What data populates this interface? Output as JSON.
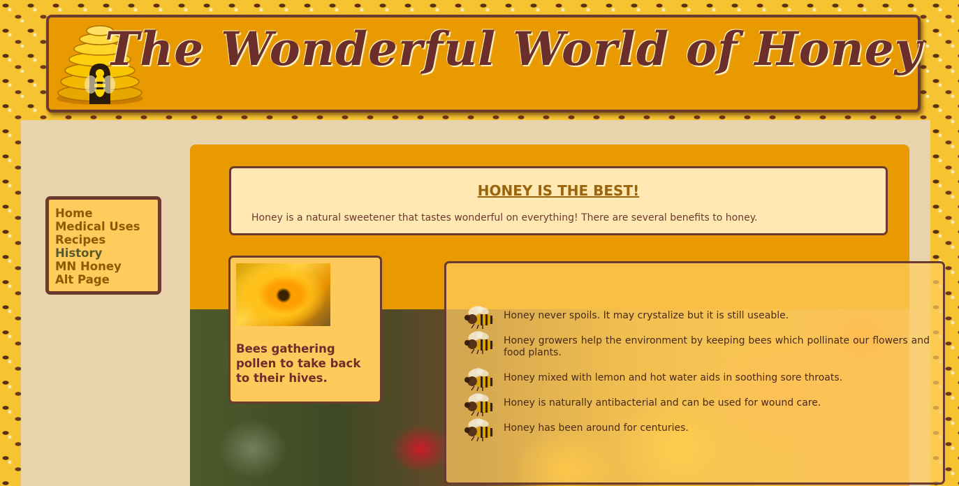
{
  "header": {
    "title": "The Wonderful World of Honey"
  },
  "nav": {
    "items": [
      {
        "label": "Home"
      },
      {
        "label": "Medical Uses"
      },
      {
        "label": "Recipes"
      },
      {
        "label": "History"
      },
      {
        "label": "MN Honey"
      },
      {
        "label": "Alt Page"
      }
    ]
  },
  "intro": {
    "title": "HONEY IS THE BEST!",
    "text": "Honey is a natural sweetener that tastes wonderful on everything! There are several benefits to honey."
  },
  "caption": {
    "text": "Bees gathering pollen to take back to their hives."
  },
  "benefits": {
    "icon": "bee-icon",
    "items": [
      "Honey never spoils. It may crystalize but it is still useable.",
      "Honey growers help the environment by keeping bees which pollinate our flowers and food plants.",
      "Honey mixed with lemon and hot water aids in soothing sore throats.",
      "Honey is naturally antibacterial and can be used for wound care.",
      "Honey has been around for centuries."
    ]
  },
  "colors": {
    "header_bg": "#e89a00",
    "border": "#6b3a2e",
    "title_text": "#6b2e2a",
    "nav_link": "#8a5b00",
    "page_bg": "#e8d3ac"
  }
}
